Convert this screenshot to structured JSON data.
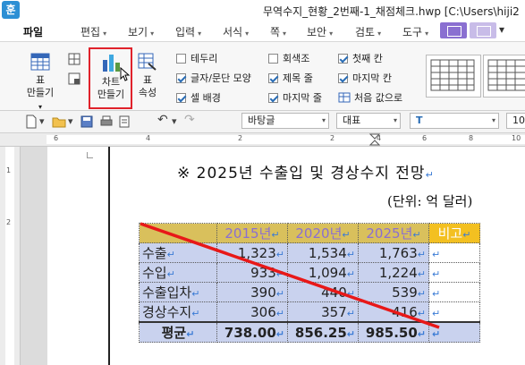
{
  "window": {
    "app_icon_label": "훈",
    "title": "무역수지_현황_2번째-1_채점체크.hwp [C:\\Users\\hiji2"
  },
  "menu": {
    "file": "파일",
    "items": [
      "편집",
      "보기",
      "입력",
      "서식",
      "쪽",
      "보안",
      "검토",
      "도구"
    ]
  },
  "ribbon": {
    "table_btn": {
      "line1": "표",
      "line2": "만들기"
    },
    "chart_btn": {
      "line1": "차트",
      "line2": "만들기"
    },
    "props_btn": {
      "line1": "표",
      "line2": "속성"
    },
    "checks": [
      {
        "label": "테두리",
        "checked": false
      },
      {
        "label": "글자/문단 모양",
        "checked": true
      },
      {
        "label": "셀 배경",
        "checked": true
      },
      {
        "label": "회색조",
        "checked": false
      },
      {
        "label": "제목 줄",
        "checked": true
      },
      {
        "label": "마지막 줄",
        "checked": true
      },
      {
        "label": "첫째 칸",
        "checked": true
      },
      {
        "label": "마지막 칸",
        "checked": true
      }
    ],
    "reset_label": "처음 값으로"
  },
  "format_bar": {
    "style_value": "바탕글",
    "font_lang": "대표",
    "font_size": "10"
  },
  "ruler": {
    "h_numbers": [
      "6",
      "4",
      "2",
      "2",
      "4",
      "6",
      "8",
      "10"
    ],
    "v_numbers": [
      "1",
      "2"
    ]
  },
  "document": {
    "title": "※ 2025년 수출입 및 경상수지 전망",
    "unit": "(단위: 억 달러)",
    "table": {
      "headers": [
        "2015년",
        "2020년",
        "2025년",
        "비고"
      ],
      "rows": [
        {
          "label": "수출",
          "values": [
            "1,323",
            "1,534",
            "1,763"
          ]
        },
        {
          "label": "수입",
          "values": [
            "933",
            "1,094",
            "1,224"
          ]
        },
        {
          "label": "수출입차",
          "values": [
            "390",
            "440",
            "539"
          ]
        },
        {
          "label": "경상수지",
          "values": [
            "306",
            "357",
            "416"
          ]
        }
      ],
      "average": {
        "label": "평균",
        "values": [
          "738.00",
          "856.25",
          "985.50"
        ]
      }
    }
  },
  "colors": {
    "highlight": "#e0222b",
    "header_bg": "#d9c05c",
    "cell_bg": "#c9d2ee",
    "header_text": "#8a6fd1"
  }
}
